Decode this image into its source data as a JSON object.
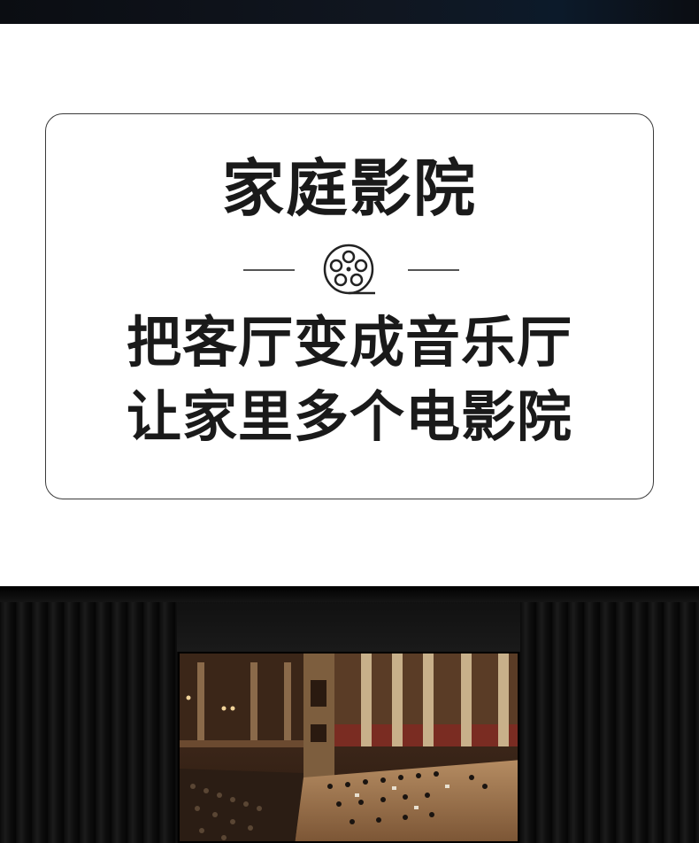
{
  "hero": {
    "title": "家庭影院",
    "tagline_line1": "把客厅变成音乐厅",
    "tagline_line2": "让家里多个电影院",
    "divider_icon": "film-reel-icon"
  },
  "showcase": {
    "image": "tv-showing-concert-hall-photo",
    "curtain_color": "#141414"
  },
  "colors": {
    "text": "#1a1a1a",
    "card_border": "#3a3a3a",
    "background": "#ffffff"
  }
}
